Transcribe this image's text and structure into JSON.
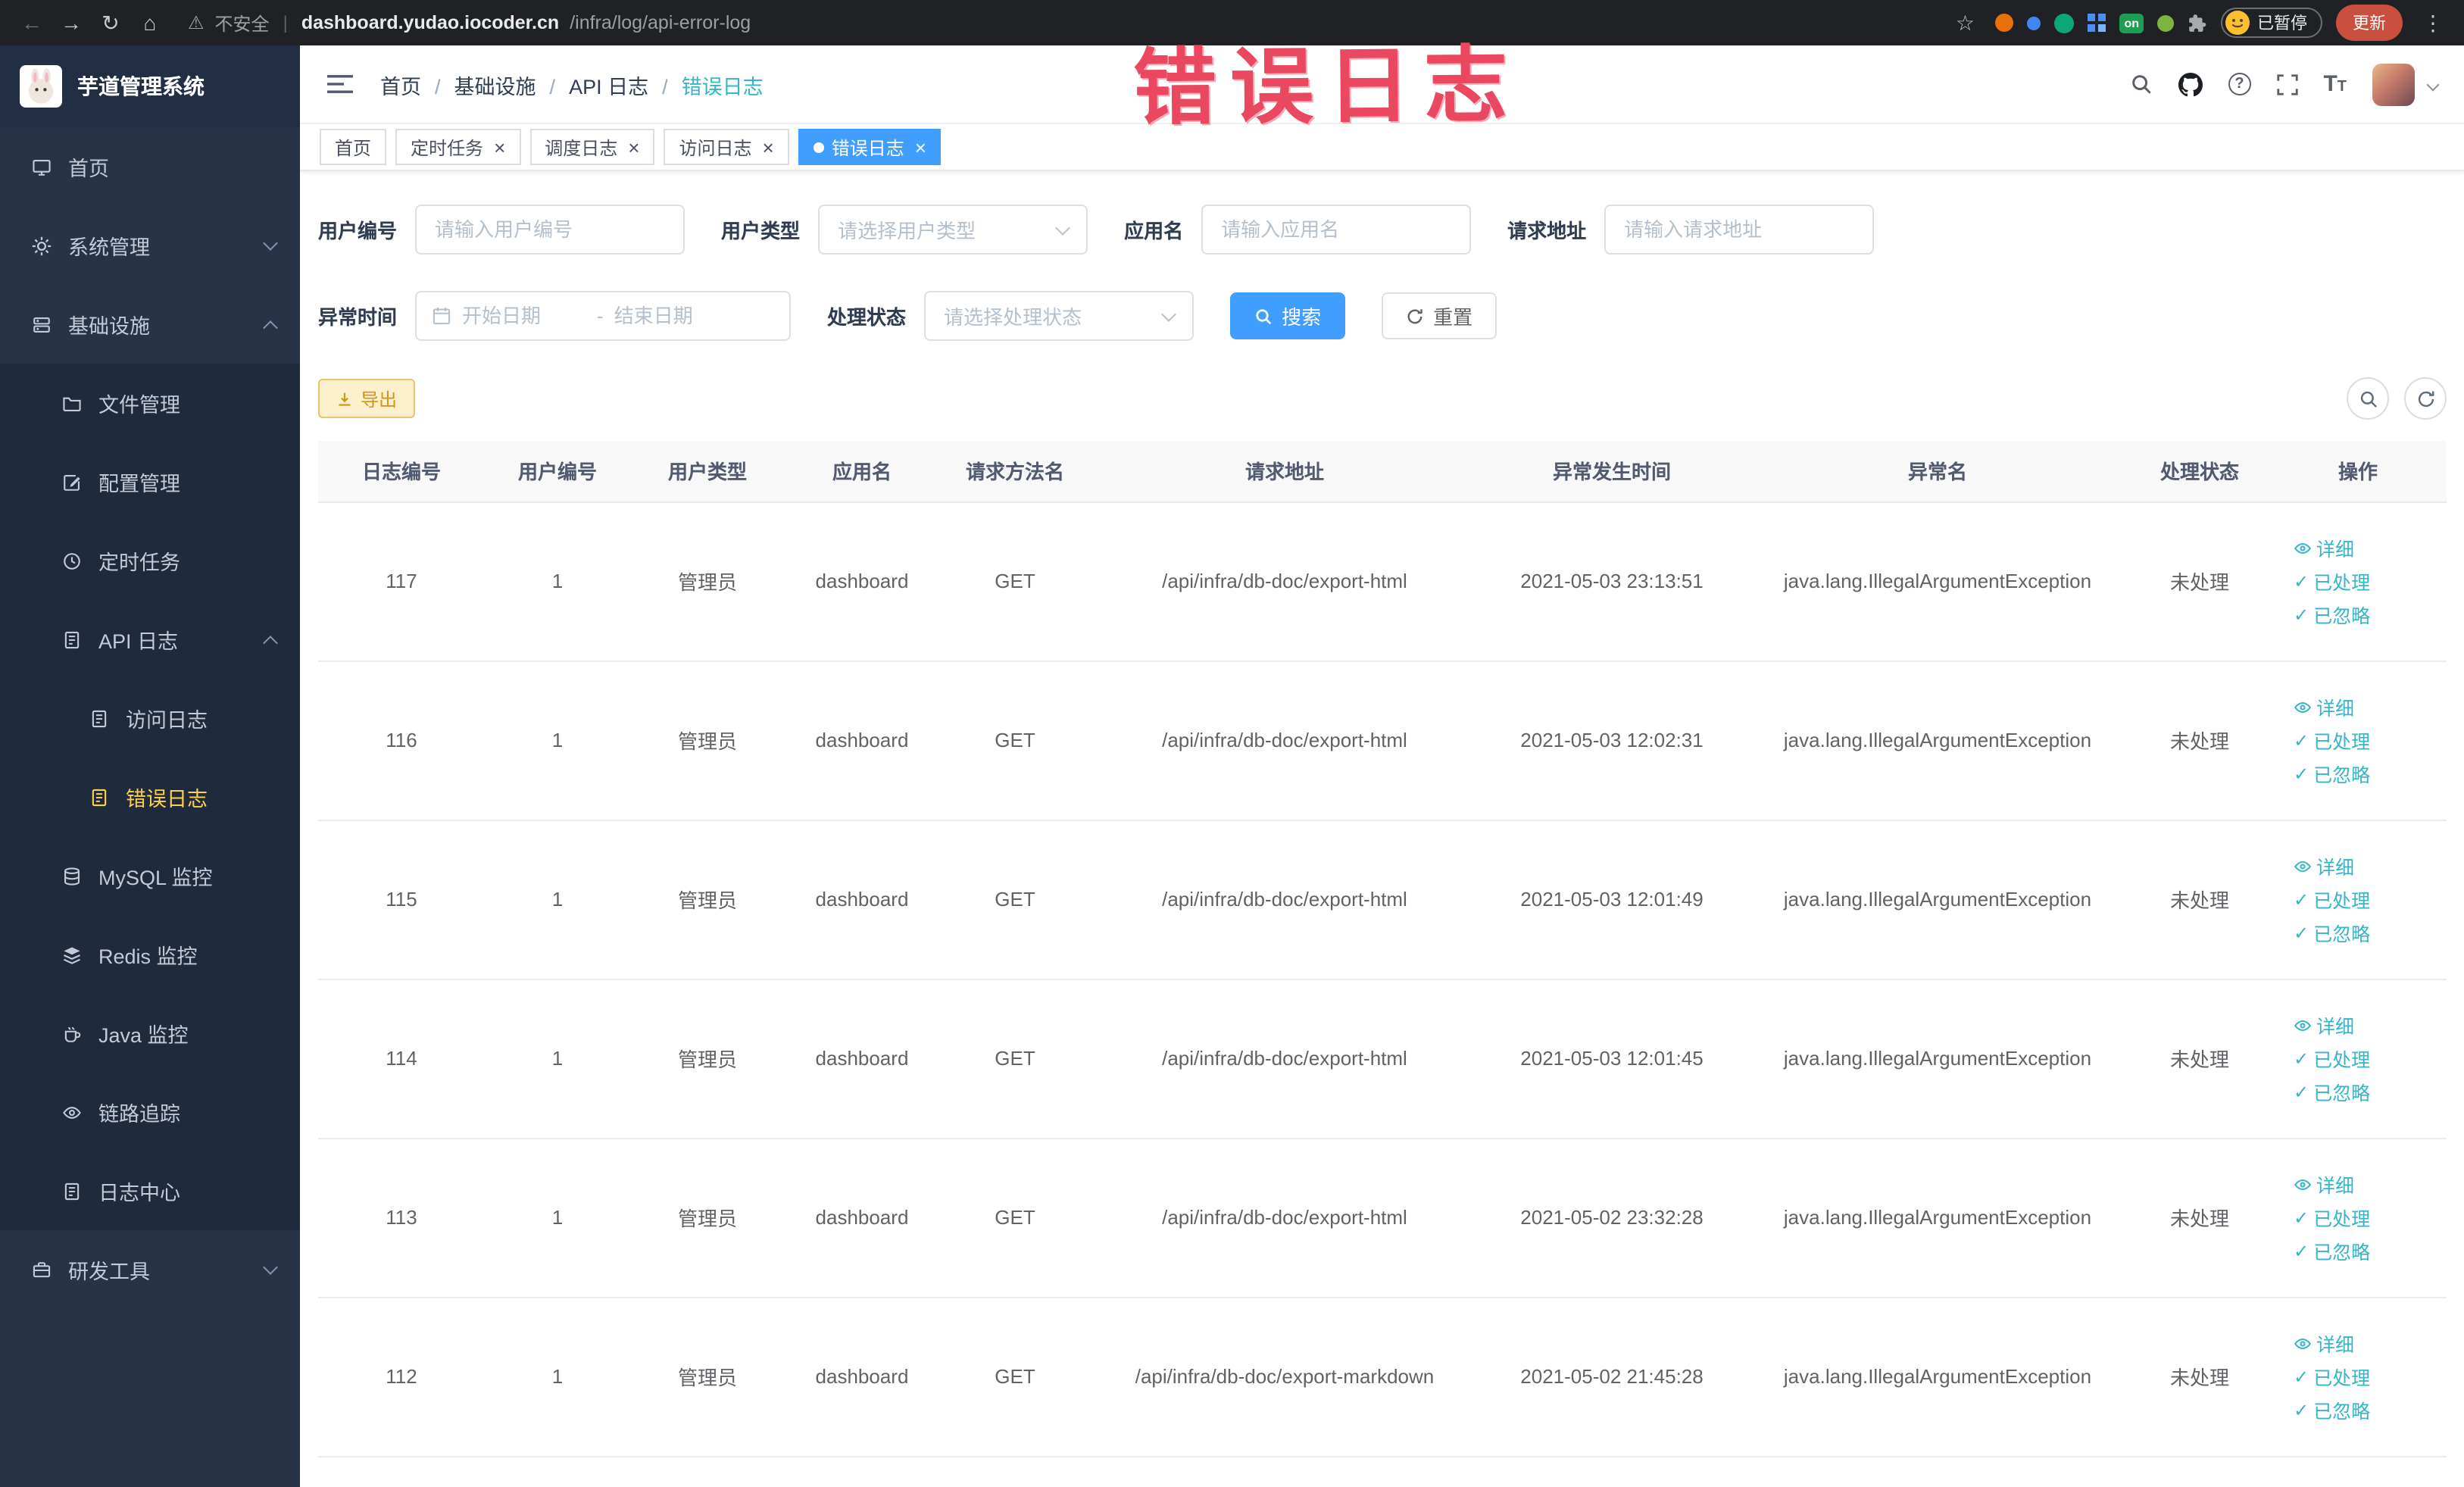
{
  "watermark": "错误日志",
  "colors": {
    "primary": "#409eff",
    "link_teal": "#36b4c8",
    "warning": "#e6a23c",
    "sidebar_bg": "#273347",
    "sidebar_active": "#ffd04b",
    "watermark_red": "#ea4760"
  },
  "browser": {
    "security_label": "不安全",
    "url_host": "dashboard.yudao.iocoder.cn",
    "url_path": "/infra/log/api-error-log",
    "extension_on_badge": "on",
    "profile_badge": "已暂停",
    "update_button": "更新"
  },
  "sidebar": {
    "title": "芋道管理系统",
    "menu": {
      "home": "首页",
      "system": "系统管理",
      "infra": "基础设施",
      "file_manage": "文件管理",
      "config_manage": "配置管理",
      "scheduled_jobs": "定时任务",
      "api_log": "API 日志",
      "access_log": "访问日志",
      "error_log": "错误日志",
      "mysql": "MySQL 监控",
      "redis": "Redis 监控",
      "java": "Java 监控",
      "trace": "链路追踪",
      "log_center": "日志中心",
      "dev_tools": "研发工具"
    }
  },
  "header": {
    "breadcrumb": [
      "首页",
      "基础设施",
      "API 日志",
      "错误日志"
    ]
  },
  "tabs": [
    {
      "label": "首页",
      "closable": false,
      "active": false
    },
    {
      "label": "定时任务",
      "closable": true,
      "active": false
    },
    {
      "label": "调度日志",
      "closable": true,
      "active": false
    },
    {
      "label": "访问日志",
      "closable": true,
      "active": false
    },
    {
      "label": "错误日志",
      "closable": true,
      "active": true
    }
  ],
  "filters": {
    "user_id": {
      "label": "用户编号",
      "placeholder": "请输入用户编号"
    },
    "user_type": {
      "label": "用户类型",
      "placeholder": "请选择用户类型"
    },
    "app_name": {
      "label": "应用名",
      "placeholder": "请输入应用名"
    },
    "request_url": {
      "label": "请求地址",
      "placeholder": "请输入请求地址"
    },
    "exception_time": {
      "label": "异常时间",
      "start_placeholder": "开始日期",
      "separator": "-",
      "end_placeholder": "结束日期"
    },
    "process_status": {
      "label": "处理状态",
      "placeholder": "请选择处理状态"
    },
    "search_label": "搜索",
    "reset_label": "重置"
  },
  "toolbar": {
    "export_label": "导出"
  },
  "table": {
    "columns": [
      "日志编号",
      "用户编号",
      "用户类型",
      "应用名",
      "请求方法名",
      "请求地址",
      "异常发生时间",
      "异常名",
      "处理状态",
      "操作"
    ],
    "actions": {
      "detail": "详细",
      "processed": "已处理",
      "ignored": "已忽略"
    },
    "rows": [
      {
        "id": "117",
        "user_id": "1",
        "user_type": "管理员",
        "app_name": "dashboard",
        "method": "GET",
        "url": "/api/infra/db-doc/export-html",
        "time": "2021-05-03 23:13:51",
        "exception": "java.lang.IllegalArgumentException",
        "status": "未处理"
      },
      {
        "id": "116",
        "user_id": "1",
        "user_type": "管理员",
        "app_name": "dashboard",
        "method": "GET",
        "url": "/api/infra/db-doc/export-html",
        "time": "2021-05-03 12:02:31",
        "exception": "java.lang.IllegalArgumentException",
        "status": "未处理"
      },
      {
        "id": "115",
        "user_id": "1",
        "user_type": "管理员",
        "app_name": "dashboard",
        "method": "GET",
        "url": "/api/infra/db-doc/export-html",
        "time": "2021-05-03 12:01:49",
        "exception": "java.lang.IllegalArgumentException",
        "status": "未处理"
      },
      {
        "id": "114",
        "user_id": "1",
        "user_type": "管理员",
        "app_name": "dashboard",
        "method": "GET",
        "url": "/api/infra/db-doc/export-html",
        "time": "2021-05-03 12:01:45",
        "exception": "java.lang.IllegalArgumentException",
        "status": "未处理"
      },
      {
        "id": "113",
        "user_id": "1",
        "user_type": "管理员",
        "app_name": "dashboard",
        "method": "GET",
        "url": "/api/infra/db-doc/export-html",
        "time": "2021-05-02 23:32:28",
        "exception": "java.lang.IllegalArgumentException",
        "status": "未处理"
      },
      {
        "id": "112",
        "user_id": "1",
        "user_type": "管理员",
        "app_name": "dashboard",
        "method": "GET",
        "url": "/api/infra/db-doc/export-markdown",
        "time": "2021-05-02 21:45:28",
        "exception": "java.lang.IllegalArgumentException",
        "status": "未处理"
      }
    ]
  }
}
